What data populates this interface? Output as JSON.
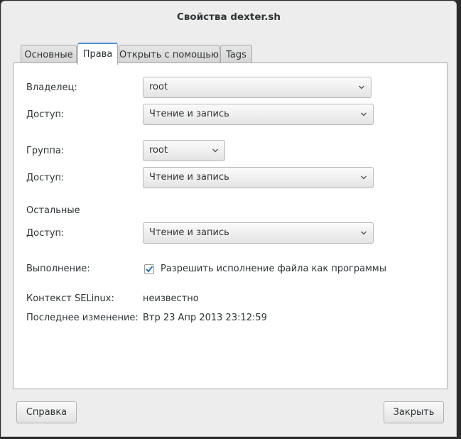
{
  "window": {
    "title": "Свойства dexter.sh"
  },
  "tabs": [
    {
      "label": "Основные"
    },
    {
      "label": "Права"
    },
    {
      "label": "Открыть с помощью"
    },
    {
      "label": "Tags"
    }
  ],
  "active_tab": "Права",
  "owner": {
    "label": "Владелец:",
    "value": "root",
    "access_label": "Доступ:",
    "access_value": "Чтение и запись"
  },
  "group": {
    "label": "Группа:",
    "value": "root",
    "access_label": "Доступ:",
    "access_value": "Чтение и запись"
  },
  "others": {
    "label": "Остальные",
    "access_label": "Доступ:",
    "access_value": "Чтение и запись"
  },
  "execute": {
    "label": "Выполнение:",
    "checkbox_label": "Разрешить исполнение файла как программы",
    "checked": true
  },
  "selinux": {
    "label": "Контекст SELinux:",
    "value": "неизвестно"
  },
  "modified": {
    "label": "Последнее изменение:",
    "value": "Втр 23 Апр 2013 23:12:59"
  },
  "footer": {
    "help_label": "Справка",
    "close_label": "Закрыть"
  },
  "colors": {
    "accent": "#4a90d9",
    "check": "#3b73b9"
  },
  "icons": {
    "dropdown": "chevron-down-icon",
    "check": "checkmark-icon"
  }
}
